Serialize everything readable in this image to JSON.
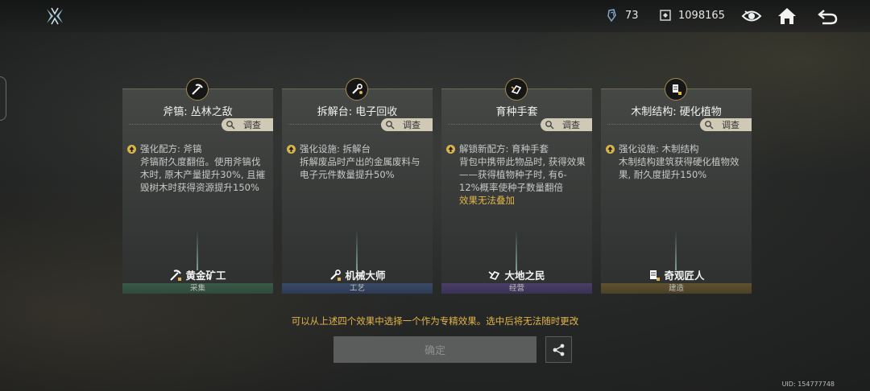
{
  "topbar": {
    "resource_a": "73",
    "resource_b": "1098165"
  },
  "cards": [
    {
      "title": "斧镐: 丛林之敌",
      "investigate": "调查",
      "effect_head": "强化配方: 斧镐",
      "effect_body": "斧镐耐久度翻倍。使用斧镐伐木时, 原木产量提升30%, 且摧毁树木时获得资源提升150%",
      "warning": "",
      "specialty": "黄金矿工",
      "category": "采集"
    },
    {
      "title": "拆解台: 电子回收",
      "investigate": "调查",
      "effect_head": "强化设施: 拆解台",
      "effect_body": "拆解废品时产出的金属废料与电子元件数量提升50%",
      "warning": "",
      "specialty": "机械大师",
      "category": "工艺"
    },
    {
      "title": "育种手套",
      "investigate": "调查",
      "effect_head": "解锁新配方: 育种手套",
      "effect_body": "背包中携带此物品时, 获得效果——获得植物种子时, 有6-12%概率使种子数量翻倍",
      "warning": "效果无法叠加",
      "specialty": "大地之民",
      "category": "经营"
    },
    {
      "title": "木制结构: 硬化植物",
      "investigate": "调查",
      "effect_head": "强化设施: 木制结构",
      "effect_body": "木制结构建筑获得硬化植物效果, 耐久度提升150%",
      "warning": "",
      "specialty": "奇观匠人",
      "category": "建造"
    }
  ],
  "notice": "可以从上述四个效果中选择一个作为专精效果。选中后将无法随时更改",
  "confirm_label": "确定",
  "uid": "UID: 154777748",
  "icons": {
    "logo": "x-logo-icon",
    "resource_a": "crystal-icon",
    "resource_b": "coin-box-icon",
    "eye": "eye-icon",
    "home": "home-icon",
    "back": "back-arrow-icon",
    "share": "share-icon"
  },
  "colors": {
    "accent_gold": "#e3b54a",
    "cat_gather": "#3b5a48",
    "cat_craft": "#3b4a66",
    "cat_manage": "#4a3f66",
    "cat_build": "#5e5230"
  }
}
